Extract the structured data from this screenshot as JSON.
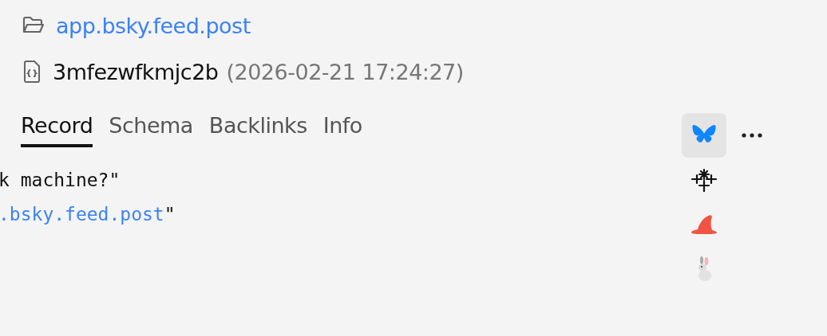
{
  "breadcrumb": {
    "collection": "app.bsky.feed.post",
    "record_key": "3mfezwfkmjc2b",
    "timestamp": "(2026-02-21 17:24:27)"
  },
  "tabs": [
    {
      "label": "Record",
      "selected": true
    },
    {
      "label": "Schema",
      "selected": false
    },
    {
      "label": "Backlinks",
      "selected": false
    },
    {
      "label": "Info",
      "selected": false
    }
  ],
  "code_lines": [
    [
      {
        "kind": "plain",
        "text": "k machine?\""
      }
    ],
    [
      {
        "kind": "value",
        "text": ".bsky.feed.post"
      },
      {
        "kind": "plain",
        "text": "\""
      }
    ]
  ],
  "apps": [
    {
      "kind": "butterfly",
      "selected": true
    },
    {
      "kind": "sparkles",
      "selected": false
    },
    {
      "kind": "hat",
      "selected": false
    },
    {
      "kind": "rabbit",
      "selected": false
    }
  ]
}
